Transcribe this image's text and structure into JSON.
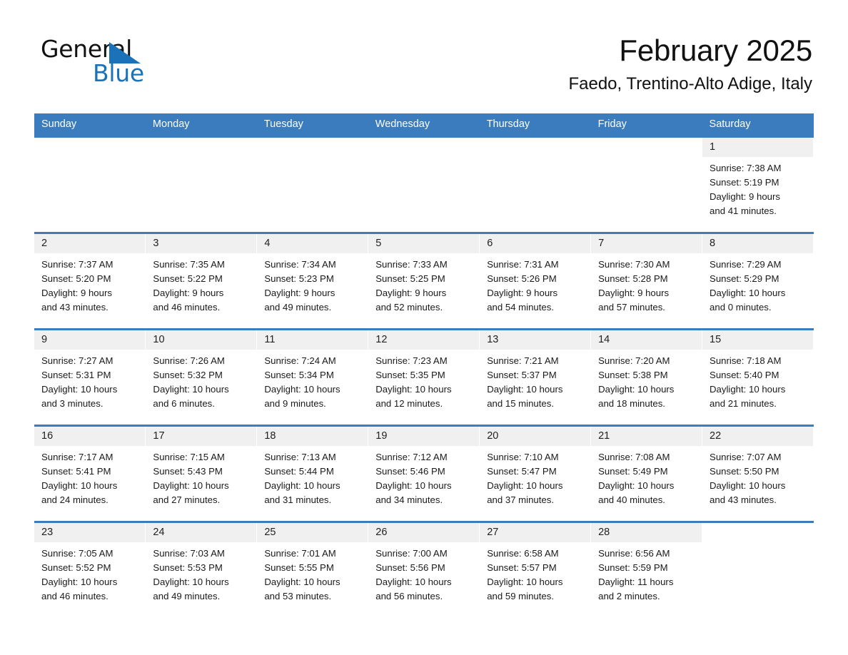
{
  "brand": {
    "name_part1": "General",
    "name_part2": "Blue",
    "triangle_color": "#1b72b8",
    "logo_icon": "triangle-logo-icon"
  },
  "header": {
    "title": "February 2025",
    "subtitle": "Faedo, Trentino-Alto Adige, Italy"
  },
  "theme": {
    "header_blue": "#3a7cbd",
    "daynum_band": "#f0f0f0",
    "text": "#1a1a1a"
  },
  "weekday_headers": [
    "Sunday",
    "Monday",
    "Tuesday",
    "Wednesday",
    "Thursday",
    "Friday",
    "Saturday"
  ],
  "weeks": [
    {
      "days": [
        {
          "date": "",
          "blank": true,
          "sunrise": "",
          "sunset": "",
          "daylight_line1": "",
          "daylight_line2": ""
        },
        {
          "date": "",
          "blank": true,
          "sunrise": "",
          "sunset": "",
          "daylight_line1": "",
          "daylight_line2": ""
        },
        {
          "date": "",
          "blank": true,
          "sunrise": "",
          "sunset": "",
          "daylight_line1": "",
          "daylight_line2": ""
        },
        {
          "date": "",
          "blank": true,
          "sunrise": "",
          "sunset": "",
          "daylight_line1": "",
          "daylight_line2": ""
        },
        {
          "date": "",
          "blank": true,
          "sunrise": "",
          "sunset": "",
          "daylight_line1": "",
          "daylight_line2": ""
        },
        {
          "date": "",
          "blank": true,
          "sunrise": "",
          "sunset": "",
          "daylight_line1": "",
          "daylight_line2": ""
        },
        {
          "date": "1",
          "blank": false,
          "sunrise": "Sunrise: 7:38 AM",
          "sunset": "Sunset: 5:19 PM",
          "daylight_line1": "Daylight: 9 hours",
          "daylight_line2": "and 41 minutes."
        }
      ]
    },
    {
      "days": [
        {
          "date": "2",
          "blank": false,
          "sunrise": "Sunrise: 7:37 AM",
          "sunset": "Sunset: 5:20 PM",
          "daylight_line1": "Daylight: 9 hours",
          "daylight_line2": "and 43 minutes."
        },
        {
          "date": "3",
          "blank": false,
          "sunrise": "Sunrise: 7:35 AM",
          "sunset": "Sunset: 5:22 PM",
          "daylight_line1": "Daylight: 9 hours",
          "daylight_line2": "and 46 minutes."
        },
        {
          "date": "4",
          "blank": false,
          "sunrise": "Sunrise: 7:34 AM",
          "sunset": "Sunset: 5:23 PM",
          "daylight_line1": "Daylight: 9 hours",
          "daylight_line2": "and 49 minutes."
        },
        {
          "date": "5",
          "blank": false,
          "sunrise": "Sunrise: 7:33 AM",
          "sunset": "Sunset: 5:25 PM",
          "daylight_line1": "Daylight: 9 hours",
          "daylight_line2": "and 52 minutes."
        },
        {
          "date": "6",
          "blank": false,
          "sunrise": "Sunrise: 7:31 AM",
          "sunset": "Sunset: 5:26 PM",
          "daylight_line1": "Daylight: 9 hours",
          "daylight_line2": "and 54 minutes."
        },
        {
          "date": "7",
          "blank": false,
          "sunrise": "Sunrise: 7:30 AM",
          "sunset": "Sunset: 5:28 PM",
          "daylight_line1": "Daylight: 9 hours",
          "daylight_line2": "and 57 minutes."
        },
        {
          "date": "8",
          "blank": false,
          "sunrise": "Sunrise: 7:29 AM",
          "sunset": "Sunset: 5:29 PM",
          "daylight_line1": "Daylight: 10 hours",
          "daylight_line2": "and 0 minutes."
        }
      ]
    },
    {
      "days": [
        {
          "date": "9",
          "blank": false,
          "sunrise": "Sunrise: 7:27 AM",
          "sunset": "Sunset: 5:31 PM",
          "daylight_line1": "Daylight: 10 hours",
          "daylight_line2": "and 3 minutes."
        },
        {
          "date": "10",
          "blank": false,
          "sunrise": "Sunrise: 7:26 AM",
          "sunset": "Sunset: 5:32 PM",
          "daylight_line1": "Daylight: 10 hours",
          "daylight_line2": "and 6 minutes."
        },
        {
          "date": "11",
          "blank": false,
          "sunrise": "Sunrise: 7:24 AM",
          "sunset": "Sunset: 5:34 PM",
          "daylight_line1": "Daylight: 10 hours",
          "daylight_line2": "and 9 minutes."
        },
        {
          "date": "12",
          "blank": false,
          "sunrise": "Sunrise: 7:23 AM",
          "sunset": "Sunset: 5:35 PM",
          "daylight_line1": "Daylight: 10 hours",
          "daylight_line2": "and 12 minutes."
        },
        {
          "date": "13",
          "blank": false,
          "sunrise": "Sunrise: 7:21 AM",
          "sunset": "Sunset: 5:37 PM",
          "daylight_line1": "Daylight: 10 hours",
          "daylight_line2": "and 15 minutes."
        },
        {
          "date": "14",
          "blank": false,
          "sunrise": "Sunrise: 7:20 AM",
          "sunset": "Sunset: 5:38 PM",
          "daylight_line1": "Daylight: 10 hours",
          "daylight_line2": "and 18 minutes."
        },
        {
          "date": "15",
          "blank": false,
          "sunrise": "Sunrise: 7:18 AM",
          "sunset": "Sunset: 5:40 PM",
          "daylight_line1": "Daylight: 10 hours",
          "daylight_line2": "and 21 minutes."
        }
      ]
    },
    {
      "days": [
        {
          "date": "16",
          "blank": false,
          "sunrise": "Sunrise: 7:17 AM",
          "sunset": "Sunset: 5:41 PM",
          "daylight_line1": "Daylight: 10 hours",
          "daylight_line2": "and 24 minutes."
        },
        {
          "date": "17",
          "blank": false,
          "sunrise": "Sunrise: 7:15 AM",
          "sunset": "Sunset: 5:43 PM",
          "daylight_line1": "Daylight: 10 hours",
          "daylight_line2": "and 27 minutes."
        },
        {
          "date": "18",
          "blank": false,
          "sunrise": "Sunrise: 7:13 AM",
          "sunset": "Sunset: 5:44 PM",
          "daylight_line1": "Daylight: 10 hours",
          "daylight_line2": "and 31 minutes."
        },
        {
          "date": "19",
          "blank": false,
          "sunrise": "Sunrise: 7:12 AM",
          "sunset": "Sunset: 5:46 PM",
          "daylight_line1": "Daylight: 10 hours",
          "daylight_line2": "and 34 minutes."
        },
        {
          "date": "20",
          "blank": false,
          "sunrise": "Sunrise: 7:10 AM",
          "sunset": "Sunset: 5:47 PM",
          "daylight_line1": "Daylight: 10 hours",
          "daylight_line2": "and 37 minutes."
        },
        {
          "date": "21",
          "blank": false,
          "sunrise": "Sunrise: 7:08 AM",
          "sunset": "Sunset: 5:49 PM",
          "daylight_line1": "Daylight: 10 hours",
          "daylight_line2": "and 40 minutes."
        },
        {
          "date": "22",
          "blank": false,
          "sunrise": "Sunrise: 7:07 AM",
          "sunset": "Sunset: 5:50 PM",
          "daylight_line1": "Daylight: 10 hours",
          "daylight_line2": "and 43 minutes."
        }
      ]
    },
    {
      "days": [
        {
          "date": "23",
          "blank": false,
          "sunrise": "Sunrise: 7:05 AM",
          "sunset": "Sunset: 5:52 PM",
          "daylight_line1": "Daylight: 10 hours",
          "daylight_line2": "and 46 minutes."
        },
        {
          "date": "24",
          "blank": false,
          "sunrise": "Sunrise: 7:03 AM",
          "sunset": "Sunset: 5:53 PM",
          "daylight_line1": "Daylight: 10 hours",
          "daylight_line2": "and 49 minutes."
        },
        {
          "date": "25",
          "blank": false,
          "sunrise": "Sunrise: 7:01 AM",
          "sunset": "Sunset: 5:55 PM",
          "daylight_line1": "Daylight: 10 hours",
          "daylight_line2": "and 53 minutes."
        },
        {
          "date": "26",
          "blank": false,
          "sunrise": "Sunrise: 7:00 AM",
          "sunset": "Sunset: 5:56 PM",
          "daylight_line1": "Daylight: 10 hours",
          "daylight_line2": "and 56 minutes."
        },
        {
          "date": "27",
          "blank": false,
          "sunrise": "Sunrise: 6:58 AM",
          "sunset": "Sunset: 5:57 PM",
          "daylight_line1": "Daylight: 10 hours",
          "daylight_line2": "and 59 minutes."
        },
        {
          "date": "28",
          "blank": false,
          "sunrise": "Sunrise: 6:56 AM",
          "sunset": "Sunset: 5:59 PM",
          "daylight_line1": "Daylight: 11 hours",
          "daylight_line2": "and 2 minutes."
        },
        {
          "date": "",
          "blank": true,
          "sunrise": "",
          "sunset": "",
          "daylight_line1": "",
          "daylight_line2": ""
        }
      ]
    }
  ]
}
